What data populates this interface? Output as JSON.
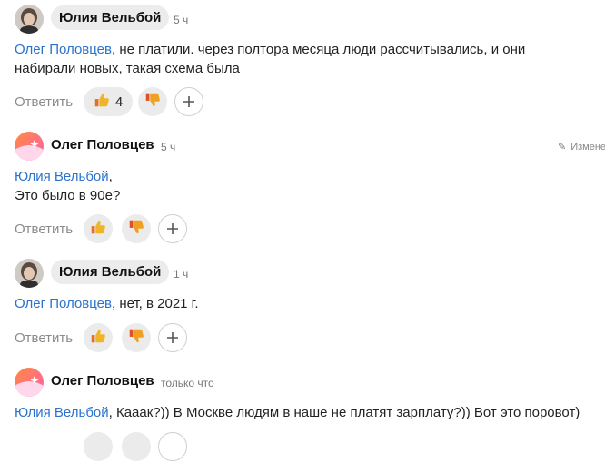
{
  "reply_label": "Ответить",
  "colors": {
    "mention": "#2a73cc",
    "like_thumb": "#f0b429",
    "dislike_thumb": "#f0a020",
    "button_bg": "#ebebeb"
  },
  "comments": [
    {
      "author": "Юлия Вельбой",
      "time": "5 ч",
      "mention": "Олег Половцев",
      "lines": [
        ", не платили. через полтора месяца люди рассчитывались, и они",
        "набирали новых, такая схема была"
      ],
      "like_count": "4"
    },
    {
      "author": "Олег Половцев",
      "time": "5 ч",
      "edit_label": "Измене",
      "mention": "Юлия Вельбой",
      "lines": [
        ",",
        "Это было в 90е?"
      ]
    },
    {
      "author": "Юлия Вельбой",
      "time": "1 ч",
      "mention": "Олег Половцев",
      "lines": [
        ", нет, в 2021 г."
      ]
    },
    {
      "author": "Олег Половцев",
      "time": "только что",
      "mention": "Юлия Вельбой",
      "lines": [
        ", Кааак?)) В Москве людям в наше не платят зарплату?)) Вот это поровот)"
      ]
    }
  ]
}
